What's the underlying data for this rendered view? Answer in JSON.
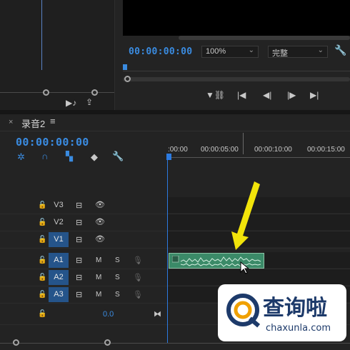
{
  "monitor": {
    "timecode": "00:00:00:00",
    "zoom": "100%",
    "fit": "完整"
  },
  "timeline": {
    "tab_name": "录音2",
    "timecode": "00:00:00:00",
    "ruler_ticks": [
      ":00:00",
      "00:00:05:00",
      "00:00:10:00",
      "00:00:15:00"
    ],
    "tracks": [
      {
        "name": "V3",
        "type": "video",
        "selected": false
      },
      {
        "name": "V2",
        "type": "video",
        "selected": false
      },
      {
        "name": "V1",
        "type": "video",
        "selected": true
      },
      {
        "name": "A1",
        "type": "audio",
        "selected": true
      },
      {
        "name": "A2",
        "type": "audio",
        "selected": true
      },
      {
        "name": "A3",
        "type": "audio",
        "selected": true
      }
    ],
    "master_value": "0.0",
    "mute_label": "M",
    "solo_label": "S"
  },
  "watermark": {
    "text": "查询啦",
    "url": "chaxunla.com"
  },
  "colors": {
    "accent": "#3a8be0",
    "clip": "#3b8a68",
    "arrow": "#f2e40a"
  }
}
